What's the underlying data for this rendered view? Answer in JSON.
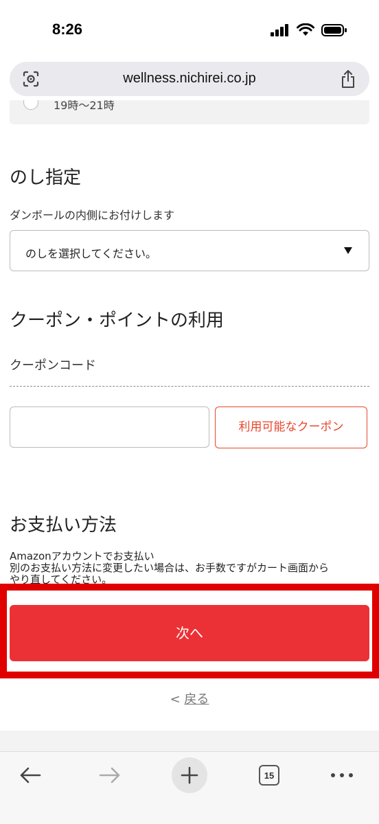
{
  "status_bar": {
    "time": "8:26"
  },
  "browser": {
    "url": "wellness.nichirei.co.jp",
    "tab_count": "15"
  },
  "delivery_time": {
    "option_label": "19時〜21時"
  },
  "noshi": {
    "title": "のし指定",
    "note": "ダンボールの内側にお付けします",
    "select_value": "のしを選択してください。"
  },
  "coupon": {
    "title": "クーポン・ポイントの利用",
    "code_label": "クーポンコード",
    "input_value": "",
    "available_button": "利用可能なクーポン"
  },
  "payment": {
    "title": "お支払い方法",
    "line1": "Amazonアカウントでお支払い",
    "line2": "別のお支払い方法に変更したい場合は、お手数ですがカート画面から",
    "line3": "やり直してください。"
  },
  "actions": {
    "next": "次へ",
    "back_prefix": "<",
    "back": "戻る"
  },
  "colors": {
    "accent": "#ec3136",
    "highlight": "#e00000",
    "coupon_accent": "#e8462c"
  }
}
